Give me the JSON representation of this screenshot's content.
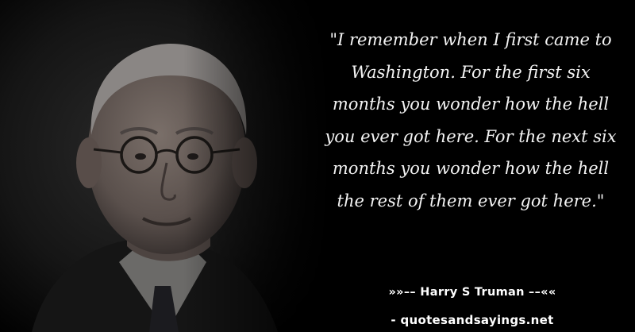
{
  "quote": {
    "text": "\"I remember when I first came to Washington. For the first six months you wonder how the hell you ever got here. For the next six months you wonder how the hell the rest of them ever got here.\""
  },
  "attribution": {
    "author_line": "»»–– Harry S Truman ––««"
  },
  "source": {
    "site_line": "- quotesandsayings.net"
  },
  "colors": {
    "background": "#000000",
    "text": "#f4f4f4"
  }
}
